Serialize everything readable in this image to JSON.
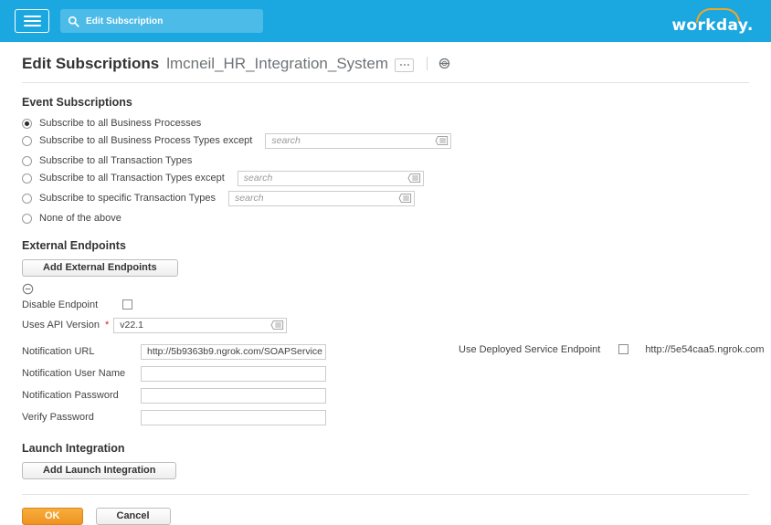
{
  "topbar": {
    "menu_icon": "hamburger-icon",
    "search_icon": "search-icon",
    "search_value": "Edit Subscription",
    "search_placeholder": "Search",
    "brand": "workday.",
    "brand_color": "#ffffff",
    "accent_color": "#f5a623",
    "bar_color": "#1ba7e0"
  },
  "title": {
    "page_title": "Edit Subscriptions",
    "subject": "lmcneil_HR_Integration_System",
    "related_actions_label": "...",
    "object_icon": "integration-system-icon"
  },
  "event_subscriptions": {
    "heading": "Event Subscriptions",
    "options": [
      {
        "label": "Subscribe to all Business Processes",
        "selected": true,
        "has_field": false
      },
      {
        "label": "Subscribe to all Business Process Types except",
        "selected": false,
        "has_field": true,
        "placeholder": "search",
        "field_width": 204
      },
      {
        "label": "Subscribe to all Transaction Types",
        "selected": false,
        "has_field": false
      },
      {
        "label": "Subscribe to all Transaction Types except",
        "selected": false,
        "has_field": true,
        "placeholder": "search",
        "field_width": 204
      },
      {
        "label": "Subscribe to specific Transaction Types",
        "selected": false,
        "has_field": true,
        "placeholder": "search",
        "field_width": 204
      },
      {
        "label": "None of the above",
        "selected": false,
        "has_field": false
      }
    ]
  },
  "external_endpoints": {
    "heading": "External Endpoints",
    "add_button": "Add External Endpoints",
    "remove_icon": "remove-circle-icon",
    "disable_endpoint_label": "Disable Endpoint",
    "disable_endpoint_checked": false,
    "api_version_label": "Uses API Version",
    "api_version_required": "*",
    "api_version_value": "v22.1",
    "fields": [
      {
        "label": "Notification URL",
        "value": "http://5b9363b9.ngrok.com/SOAPService",
        "masked": false
      },
      {
        "label": "Notification User Name",
        "value": "",
        "masked": false
      },
      {
        "label": "Notification Password",
        "value": "",
        "masked": true
      },
      {
        "label": "Verify Password",
        "value": "",
        "masked": true
      }
    ],
    "deployed_endpoint_label": "Use Deployed Service Endpoint",
    "deployed_endpoint_checked": false,
    "deployed_endpoint_url": "http://5e54caa5.ngrok.com"
  },
  "launch_integration": {
    "heading": "Launch Integration",
    "add_button": "Add Launch Integration"
  },
  "footer": {
    "ok_label": "OK",
    "cancel_label": "Cancel",
    "ok_color": "#ef9321"
  }
}
